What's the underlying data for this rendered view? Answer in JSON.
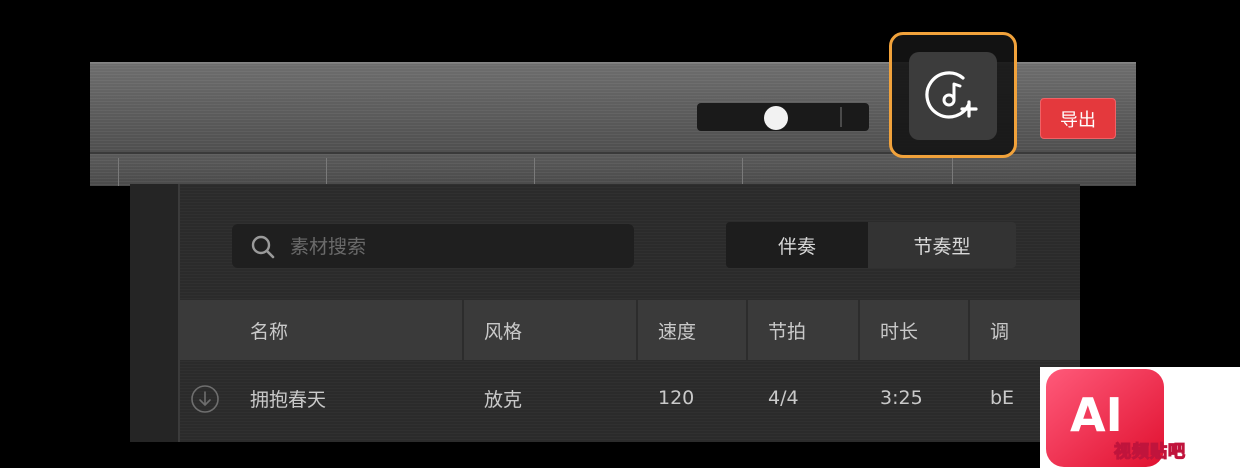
{
  "toolbar": {
    "volume_level": 0.47,
    "add_music_icon": "music-note-plus-icon",
    "export_label": "导出",
    "accent_color": "#f1a23b",
    "export_color": "#e4393d"
  },
  "panel": {
    "search": {
      "placeholder": "素材搜索",
      "value": ""
    },
    "tabs": [
      {
        "label": "伴奏",
        "active": true
      },
      {
        "label": "节奏型",
        "active": false
      }
    ],
    "columns": [
      "名称",
      "风格",
      "速度",
      "节拍",
      "时长",
      "调"
    ],
    "rows": [
      {
        "name": "拥抱春天",
        "style": "放克",
        "tempo": "120",
        "meter": "4/4",
        "duration": "3:25",
        "key": "bE"
      }
    ]
  },
  "watermark": {
    "logo_text": "AI",
    "caption": "视频贴吧"
  }
}
